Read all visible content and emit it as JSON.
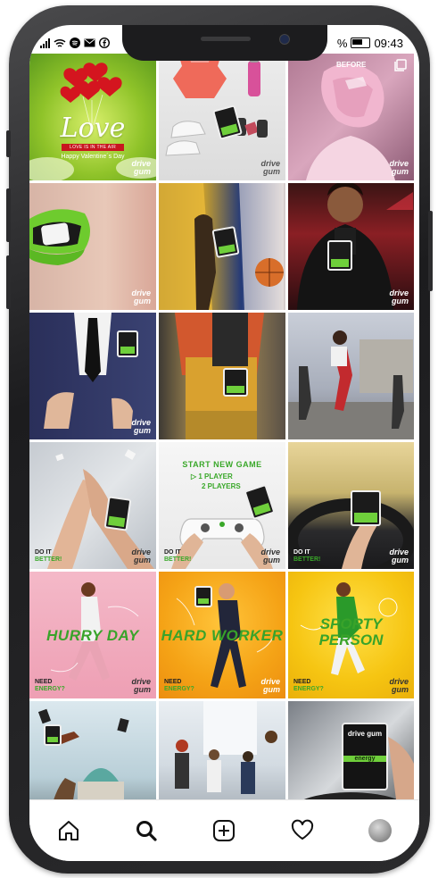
{
  "status_bar": {
    "time": "09:43",
    "battery_percent": "%",
    "icons": [
      "signal-icon",
      "wifi-icon",
      "spotify-icon",
      "mail-icon",
      "facebook-icon",
      "battery-icon"
    ]
  },
  "feed": {
    "brand": [
      "drive",
      "gum"
    ],
    "tiles": [
      {
        "id": "valentine",
        "love_text": "Love",
        "banner": "LOVE IS IN THE AIR",
        "caption": "Happy Valentine´s Day"
      },
      {
        "id": "gym-kit"
      },
      {
        "id": "before",
        "label": "BEFORE"
      },
      {
        "id": "green-lips"
      },
      {
        "id": "basketball"
      },
      {
        "id": "woman-leather"
      },
      {
        "id": "business-suit"
      },
      {
        "id": "backpack"
      },
      {
        "id": "runners"
      },
      {
        "id": "holding-hands",
        "cta": [
          "DO IT",
          "BETTER!"
        ]
      },
      {
        "id": "gamepad",
        "title": "START NEW GAME",
        "option1": "1 PLAYER",
        "option2": "2 PLAYERS",
        "cta": [
          "DO IT",
          "BETTER!"
        ]
      },
      {
        "id": "steering-wheel",
        "cta": [
          "DO IT",
          "BETTER!"
        ]
      },
      {
        "id": "hurry-day",
        "headline": "HURRY DAY",
        "cta": [
          "NEED",
          "ENERGY?"
        ]
      },
      {
        "id": "hard-worker",
        "headline": "HARD WORKER",
        "cta": [
          "NEED",
          "ENERGY?"
        ]
      },
      {
        "id": "sporty-person",
        "headline_line1": "SPORTY",
        "headline_line2": "PERSON",
        "cta": [
          "NEED",
          "ENERGY?"
        ]
      },
      {
        "id": "dome-city"
      },
      {
        "id": "office-meeting"
      },
      {
        "id": "product-closeup",
        "pack_brand": "drive gum",
        "pack_label": "energy"
      }
    ]
  },
  "bottom_nav": [
    "home-icon",
    "search-icon",
    "add-post-icon",
    "heart-icon",
    "profile-avatar"
  ],
  "colors": {
    "accent_green": "#3aa82a",
    "frame": "#1c1c1e"
  }
}
